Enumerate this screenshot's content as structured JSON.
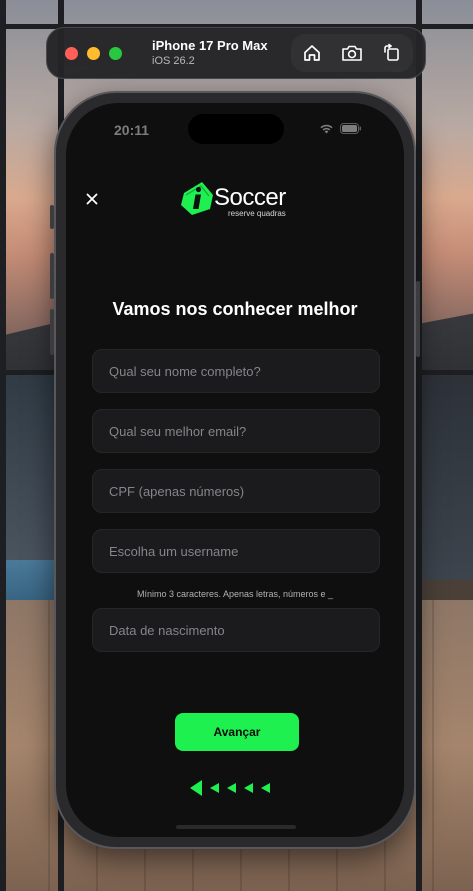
{
  "simulator": {
    "device_name": "iPhone 17 Pro Max",
    "os_version": "iOS 26.2",
    "buttons": [
      {
        "icon": "home-icon"
      },
      {
        "icon": "screenshot-icon"
      },
      {
        "icon": "rotate-icon"
      }
    ]
  },
  "status_bar": {
    "time": "20:11",
    "icons": [
      "wifi-icon",
      "battery-icon"
    ]
  },
  "app": {
    "logo": {
      "brand": "Soccer",
      "tagline": "reserve quadras",
      "accent_color": "#1ef14f"
    },
    "close_icon": "close-icon",
    "title": "Vamos nos conhecer melhor",
    "fields": {
      "full_name": {
        "placeholder": "Qual seu nome completo?",
        "value": ""
      },
      "email": {
        "placeholder": "Qual seu melhor email?",
        "value": ""
      },
      "cpf": {
        "placeholder": "CPF (apenas números)",
        "value": ""
      },
      "username": {
        "placeholder": "Escolha um username",
        "value": ""
      },
      "birth_date": {
        "placeholder": "Data de nascimento",
        "value": ""
      }
    },
    "username_hint": "Mínimo 3 caracteres. Apenas letras, números e _",
    "advance_label": "Avançar",
    "pager": {
      "total": 5,
      "current": 1
    }
  },
  "colors": {
    "accent": "#1ef14f",
    "background": "#0f0f10",
    "field_background": "#1b1b1d"
  }
}
